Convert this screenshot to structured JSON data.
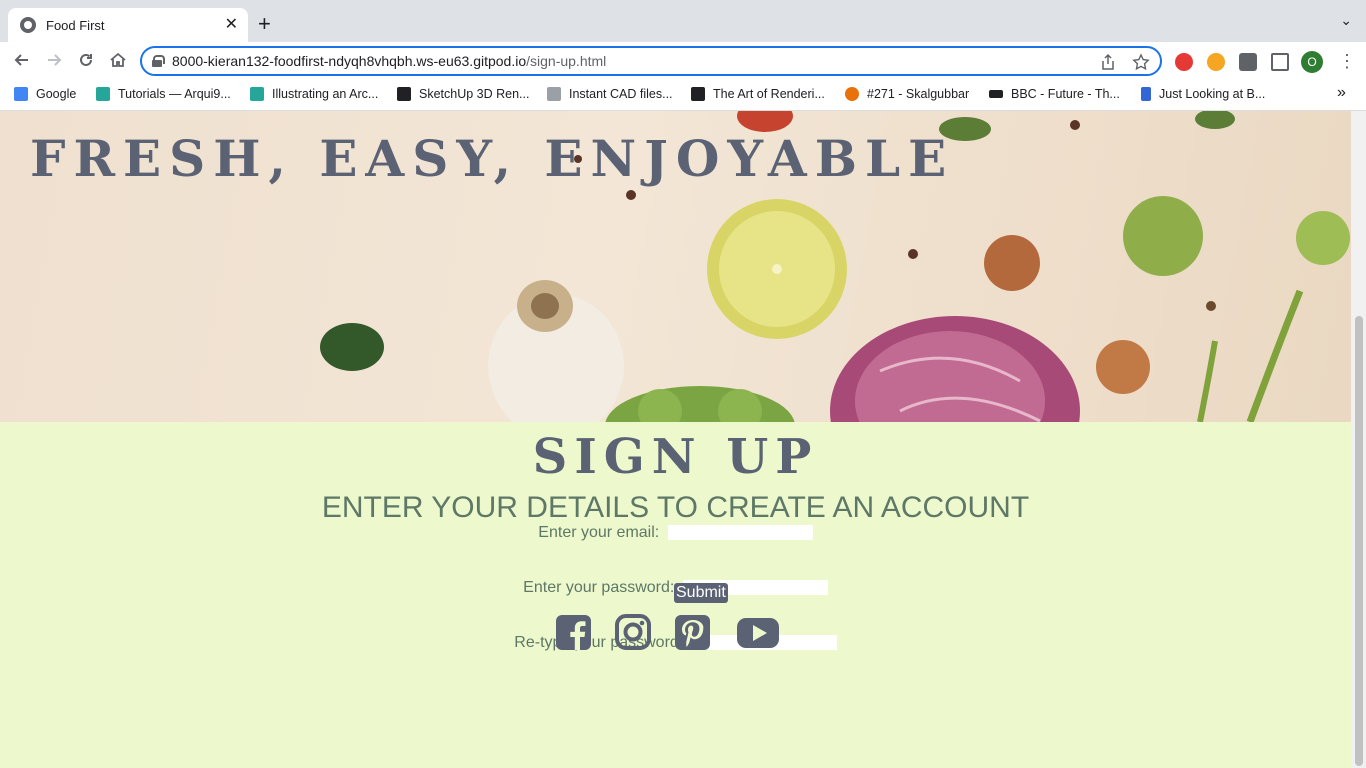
{
  "browser": {
    "tab_title": "Food First",
    "tab_close": "✕",
    "new_tab": "+",
    "tab_menu": "⌄",
    "url_host": "8000-kieran132-foodfirst-ndyqh8vhqbh.ws-eu63.gitpod.io",
    "url_path": "/sign-up.html",
    "profile_initial": "O",
    "extensions": [
      "adblock-plus-icon",
      "honey-icon",
      "puzzle-icon",
      "side-panel-icon"
    ],
    "bookmarks_overflow": "»"
  },
  "bookmarks": [
    {
      "label": "Google",
      "icon": "google-icon",
      "color": "#4285f4"
    },
    {
      "label": "Tutorials — Arqui9...",
      "icon": "arqui9-icon",
      "color": "#26a69a"
    },
    {
      "label": "Illustrating an Arc...",
      "icon": "arqui9-icon",
      "color": "#26a69a"
    },
    {
      "label": "SketchUp 3D Ren...",
      "icon": "sketchup-icon",
      "color": "#202124"
    },
    {
      "label": "Instant CAD files...",
      "icon": "cube-icon",
      "color": "#5f6368"
    },
    {
      "label": "The Art of Renderi...",
      "icon": "triangle-icon",
      "color": "#202124"
    },
    {
      "label": "#271 - Skalgubbar",
      "icon": "skalgubbar-icon",
      "color": "#e8710a"
    },
    {
      "label": "BBC - Future - Th...",
      "icon": "bbc-icon",
      "color": "#202124"
    },
    {
      "label": "Just Looking at B...",
      "icon": "shield-icon",
      "color": "#3367d6"
    }
  ],
  "page": {
    "hero_title": "FRESH, EASY, ENJOYABLE",
    "signup_title": "SIGN UP",
    "signup_subtitle": "ENTER YOUR DETAILS TO CREATE AN ACCOUNT",
    "email_label": "Enter your email:",
    "password_label": "Enter your password:",
    "retype_label": "Re-type your password:",
    "email_value": "",
    "password_value": "",
    "retype_value": "",
    "submit_label": "Submit",
    "social": [
      "facebook-icon",
      "instagram-icon",
      "pinterest-icon",
      "youtube-icon"
    ]
  },
  "colors": {
    "page_bg": "#eef8cd",
    "title": "#5b6274",
    "text_green": "#5d7866",
    "accent_blue": "#1a73e8"
  }
}
